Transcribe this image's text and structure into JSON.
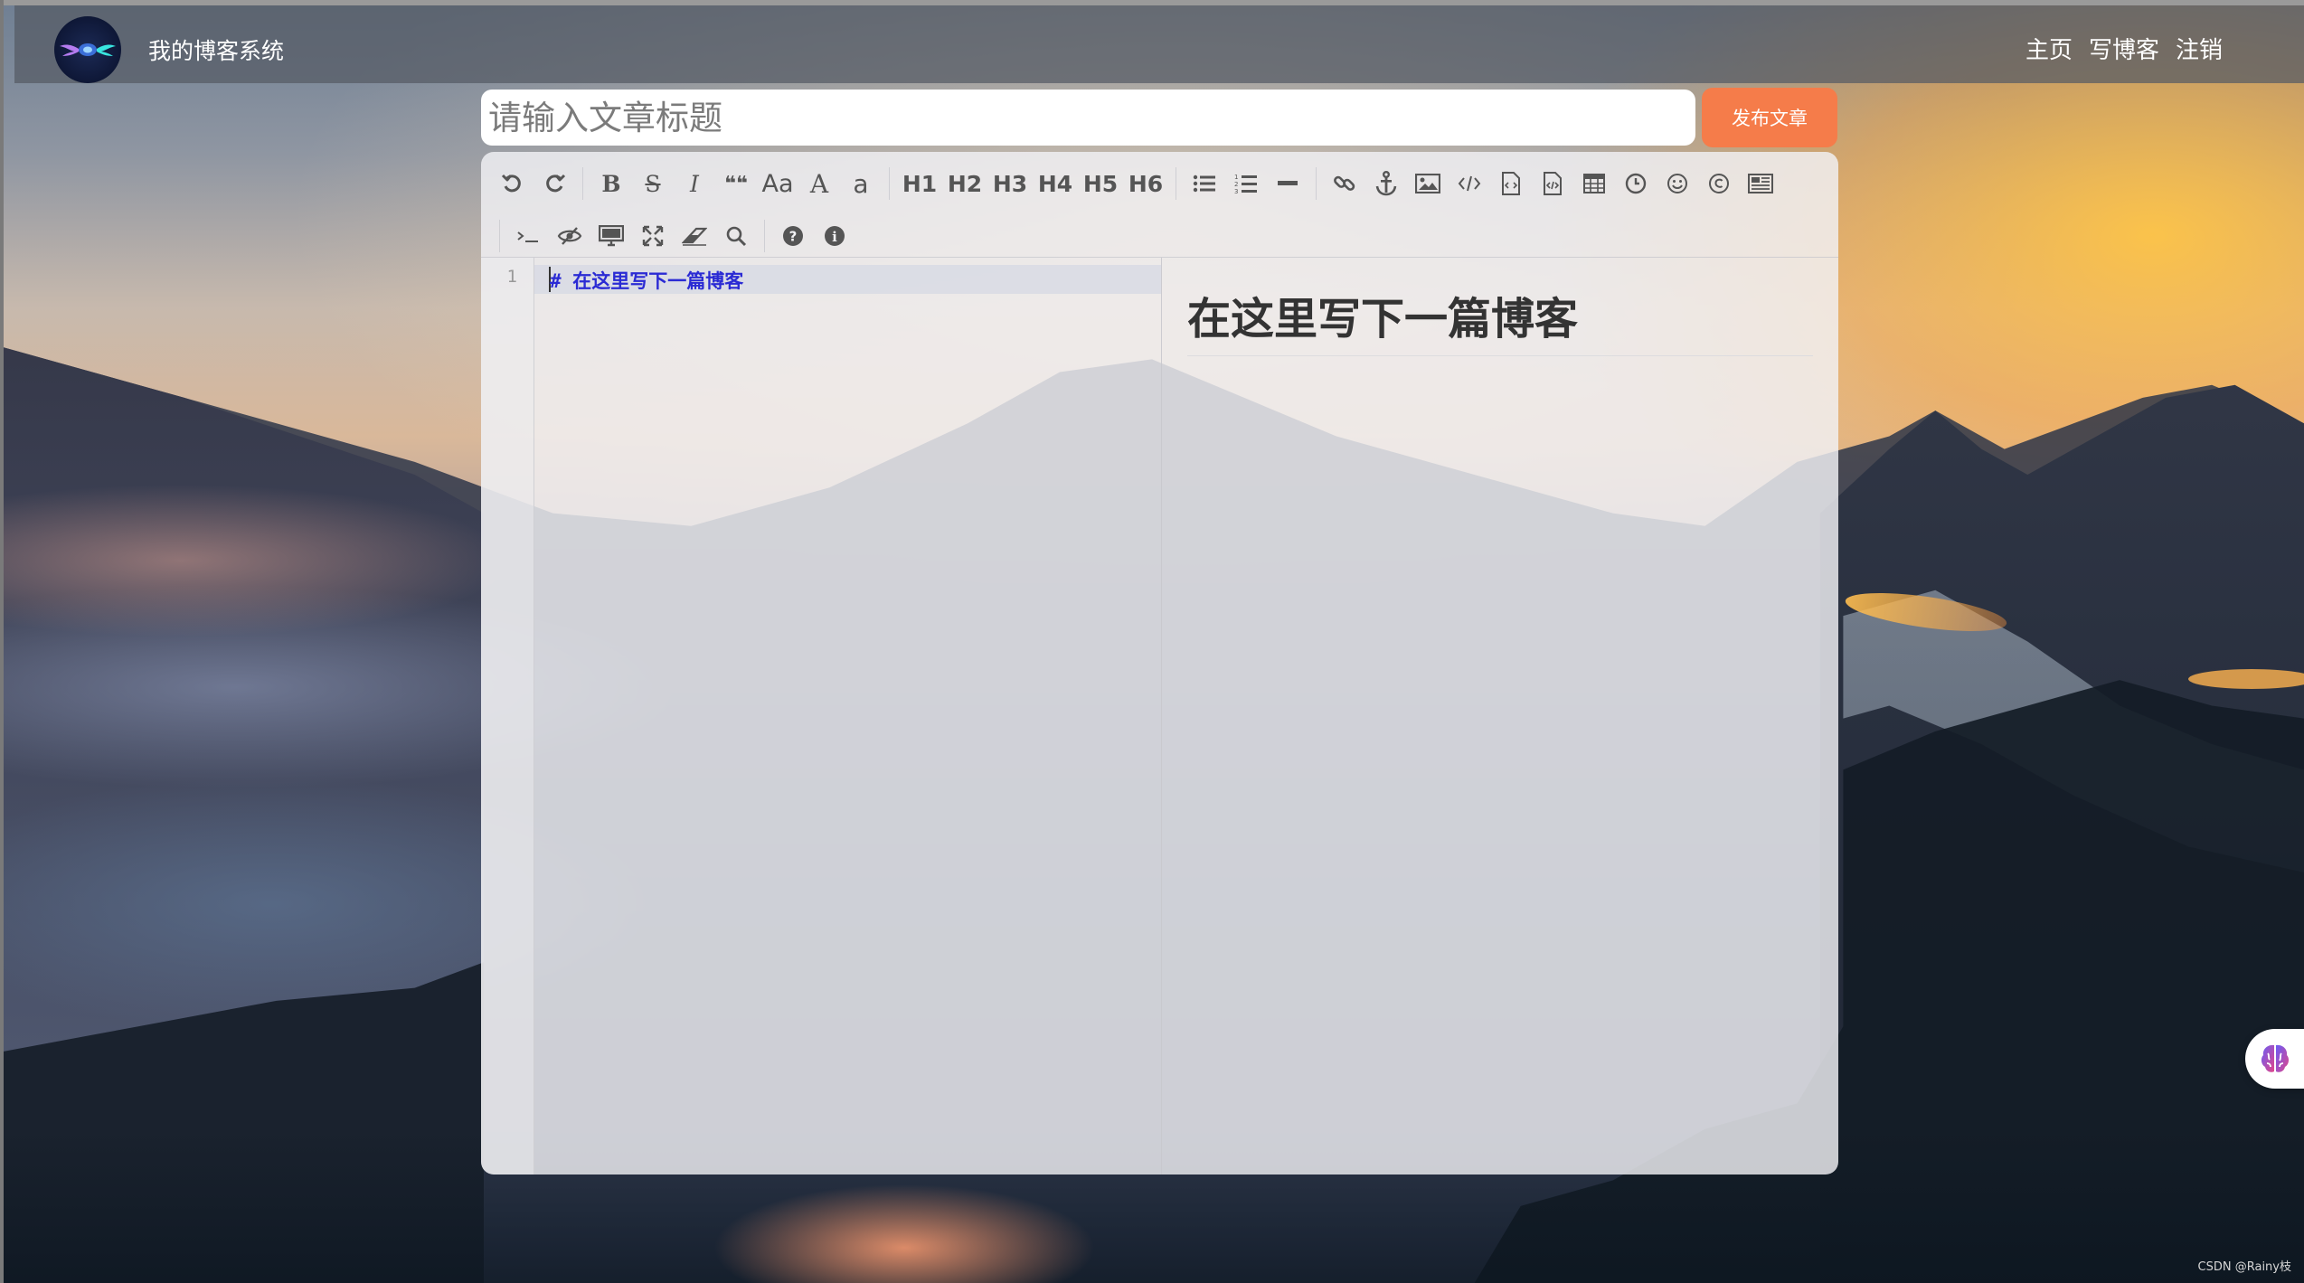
{
  "navbar": {
    "site_title": "我的博客系统",
    "links": [
      {
        "label": "主页"
      },
      {
        "label": "写博客"
      },
      {
        "label": "注销"
      }
    ],
    "logo_icon": "winged-orb-logo"
  },
  "editor_form": {
    "title_placeholder": "请输入文章标题",
    "title_value": "",
    "publish_label": "发布文章"
  },
  "toolbar": {
    "row1": [
      "undo",
      "redo",
      "bold",
      "strikethrough",
      "italic",
      "quote",
      "uppercase",
      "ucwords",
      "lowercase",
      "h1",
      "h2",
      "h3",
      "h4",
      "h5",
      "h6",
      "list-ul",
      "list-ol",
      "hr",
      "link",
      "reference-link",
      "image",
      "code",
      "preformatted-text",
      "code-block",
      "table",
      "datetime",
      "emoji",
      "html-entities",
      "pagebreak"
    ],
    "row2": [
      "goto-line",
      "watch",
      "preview",
      "fullscreen",
      "clear",
      "search",
      "help",
      "info"
    ],
    "text_labels": {
      "uppercase": "Aa",
      "ucwords": "A",
      "lowercase": "a",
      "h1": "H1",
      "h2": "H2",
      "h3": "H3",
      "h4": "H4",
      "h5": "H5",
      "h6": "H6",
      "bold": "B",
      "strike": "S",
      "italic": "I",
      "quote": "❝❝"
    }
  },
  "code": {
    "line_number": "1",
    "line_text": "# 在这里写下一篇博客"
  },
  "preview": {
    "heading": "在这里写下一篇博客"
  },
  "watermark": "CSDN @Rainy枝",
  "colors": {
    "publish_button": "#f57c4a",
    "markdown_heading": "#2b2bd4",
    "navbar_bg": "rgba(85,90,100,0.72)"
  }
}
